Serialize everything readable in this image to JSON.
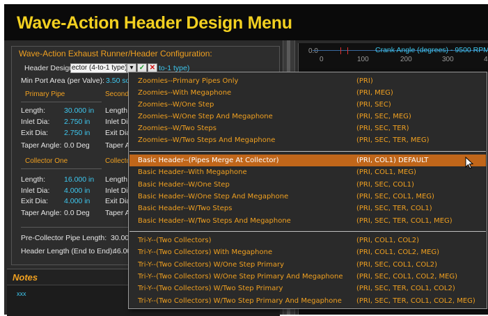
{
  "window": {
    "title": "Wave-Action Header Design Menu"
  },
  "config": {
    "panel_title": "Wave-Action Exhaust Runner/Header Configuration:",
    "header_design_label": "Header Design:",
    "header_design_value": "ector (4-to-1 type)",
    "header_design_suffix": "to-1 type)",
    "min_port_label": "Min Port Area (per Valve):",
    "min_port_value": "3.50 sq",
    "primary_title": "Primary Pipe",
    "second_title": "Second",
    "collector_one_title": "Collector One",
    "collector_two_title": "Collecto",
    "labels": {
      "length": "Length:",
      "inlet": "Inlet Dia:",
      "exit": "Exit Dia:",
      "taper": "Taper Angle:",
      "taper_short": "Taper A",
      "inlet_short": "Inlet Dia",
      "exit_short": "Exit Dia",
      "length_short": "Length:"
    },
    "primary": {
      "length": "30.000 in",
      "inlet": "2.750 in",
      "exit": "2.750 in",
      "taper": "0.0 Deg"
    },
    "collector_one": {
      "length": "16.000 in",
      "inlet": "4.000 in",
      "exit": "4.000 in",
      "taper": "0.0 Deg"
    },
    "pre_collector_label": "Pre-Collector Pipe Length:",
    "pre_collector_value": "30.00",
    "header_length_label": "Header Length (End to End):",
    "header_length_value": "46.00"
  },
  "chart": {
    "axis_title": "Crank Angle (degrees) - 9500 RPM",
    "ytick": "0.0",
    "xticks": [
      "0",
      "100",
      "200",
      "300",
      "4"
    ]
  },
  "notes": {
    "title": "Notes",
    "dots": "xxx"
  },
  "menu": {
    "groups": [
      [
        {
          "label": "Zoomies--Primary Pipes Only",
          "code": "(PRI)"
        },
        {
          "label": "Zoomies--With Megaphone",
          "code": "(PRI, MEG)"
        },
        {
          "label": "Zoomies--W/One Step",
          "code": "(PRI, SEC)"
        },
        {
          "label": "Zoomies--W/One Step And Megaphone",
          "code": "(PRI, SEC, MEG)"
        },
        {
          "label": "Zoomies--W/Two Steps",
          "code": "(PRI, SEC, TER)"
        },
        {
          "label": "Zoomies--W/Two Steps And Megaphone",
          "code": "(PRI, SEC, TER, MEG)"
        }
      ],
      [
        {
          "label": "Basic Header--(Pipes Merge At Collector)",
          "code": "(PRI, COL1)  DEFAULT"
        },
        {
          "label": "Basic Header--With Megaphone",
          "code": "(PRI, COL1, MEG)"
        },
        {
          "label": "Basic Header--W/One Step",
          "code": "(PRI, SEC, COL1)"
        },
        {
          "label": "Basic Header--W/One Step And Megaphone",
          "code": "(PRI, SEC, COL1, MEG)"
        },
        {
          "label": "Basic Header--W/Two Steps",
          "code": "(PRI, SEC, TER, COL1)"
        },
        {
          "label": "Basic Header--W/Two Steps And Megaphone",
          "code": "(PRI, SEC, TER, COL1, MEG)"
        }
      ],
      [
        {
          "label": "Tri-Y--(Two Collectors)",
          "code": "(PRI, COL1, COL2)"
        },
        {
          "label": "Tri-Y--(Two Collectors) With Megaphone",
          "code": "(PRI, COL1, COL2, MEG)"
        },
        {
          "label": "Tri-Y--(Two Collectors) W/One Step Primary",
          "code": "(PRI, SEC, COL1, COL2)"
        },
        {
          "label": "Tri-Y--(Two Collectors) W/One Step Primary And Megaphone",
          "code": "(PRI, SEC, COL1, COL2, MEG)"
        },
        {
          "label": "Tri-Y--(Two Collectors) W/Two Step Primary",
          "code": "(PRI, SEC, TER, COL1, COL2)"
        },
        {
          "label": "Tri-Y--(Two Collectors) W/Two Step Primary And Megaphone",
          "code": "(PRI, SEC, TER, COL1, COL2, MEG)"
        }
      ]
    ],
    "selected": "Basic Header--(Pipes Merge At Collector)"
  },
  "colors": {
    "accent": "#f0a020",
    "title": "#f2d020",
    "value": "#3ec8f0",
    "selected": "#c0661a"
  }
}
